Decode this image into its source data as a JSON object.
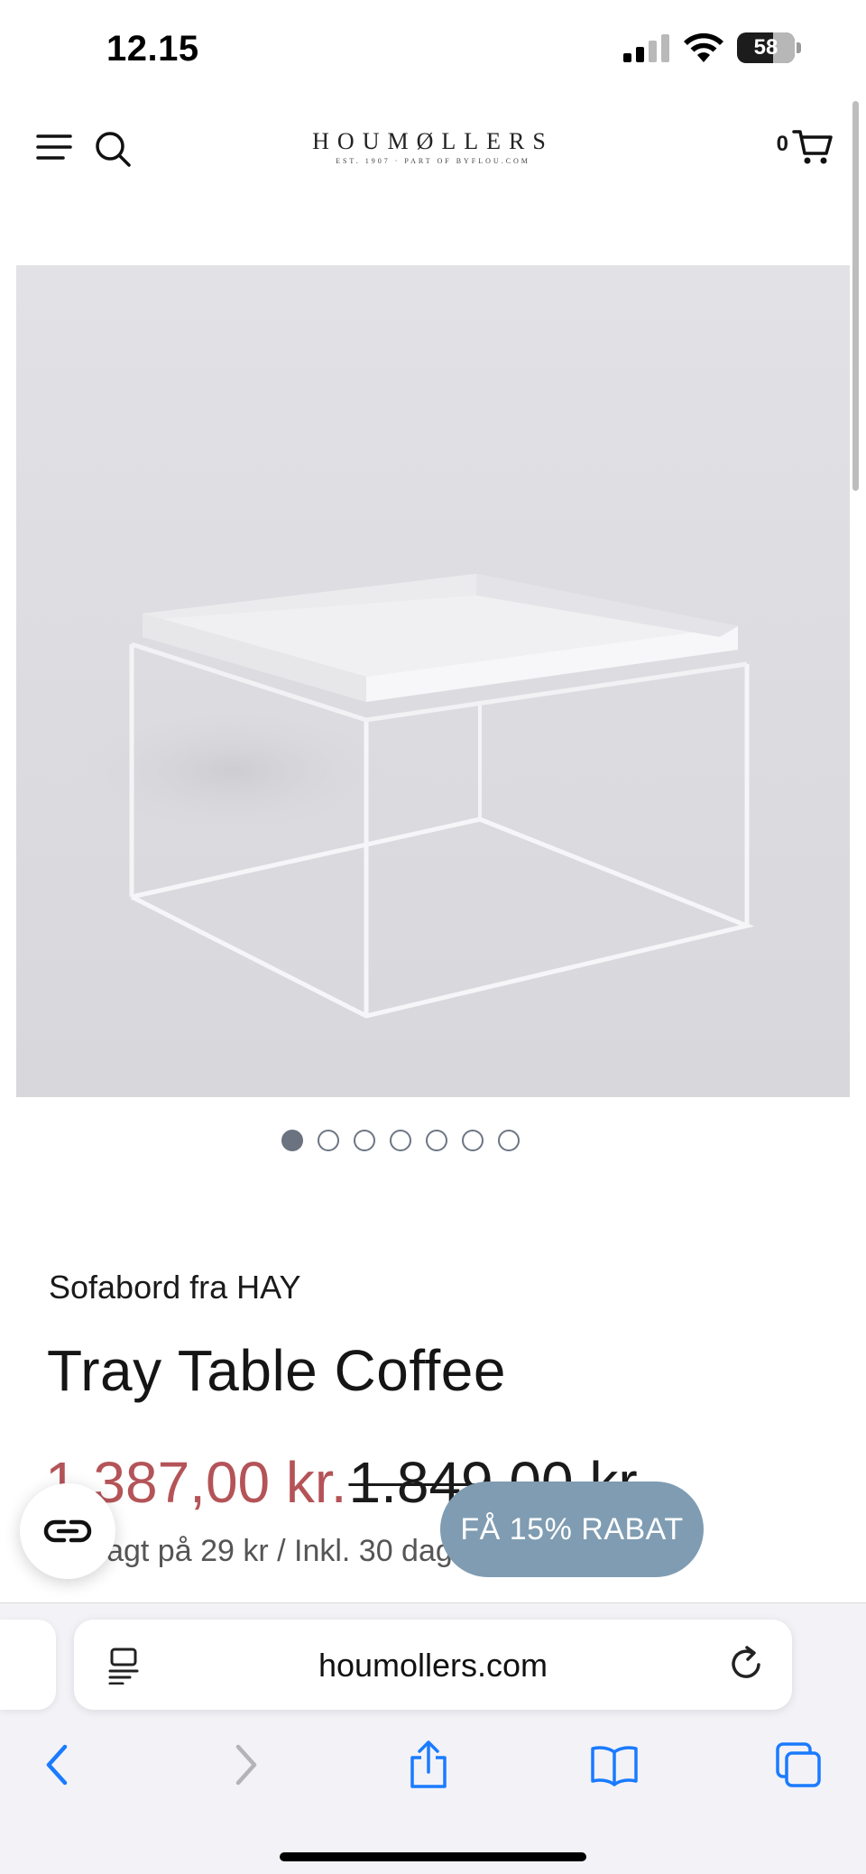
{
  "status_bar": {
    "time": "12.15",
    "battery_level": "58",
    "icons": [
      "cellular-signal-icon",
      "wifi-icon",
      "battery-icon"
    ]
  },
  "header": {
    "logo_text": "HOUMØLLERS",
    "logo_tagline": "EST. 1907 · PART OF BYFLOU.COM",
    "cart_count": "0",
    "icons": [
      "menu-icon",
      "search-icon",
      "cart-icon"
    ]
  },
  "gallery": {
    "dot_count": 7,
    "active_index": 0
  },
  "product": {
    "subtitle": "Sofabord fra HAY",
    "title": "Tray Table Coffee",
    "sale_price": "1.387,00 kr.",
    "original_price": "1.849,00 kr.",
    "shipping_note": "Fragt på 29 kr / Inkl. 30 dages returret"
  },
  "floating": {
    "discount_button": "FÅ 15% RABAT",
    "badge_icon": "link-icon"
  },
  "browser": {
    "url": "houmollers.com",
    "toolbar_icons": [
      "back-icon",
      "forward-icon",
      "share-icon",
      "bookmarks-icon",
      "tabs-icon"
    ],
    "accent_color": "#1a7bff"
  }
}
